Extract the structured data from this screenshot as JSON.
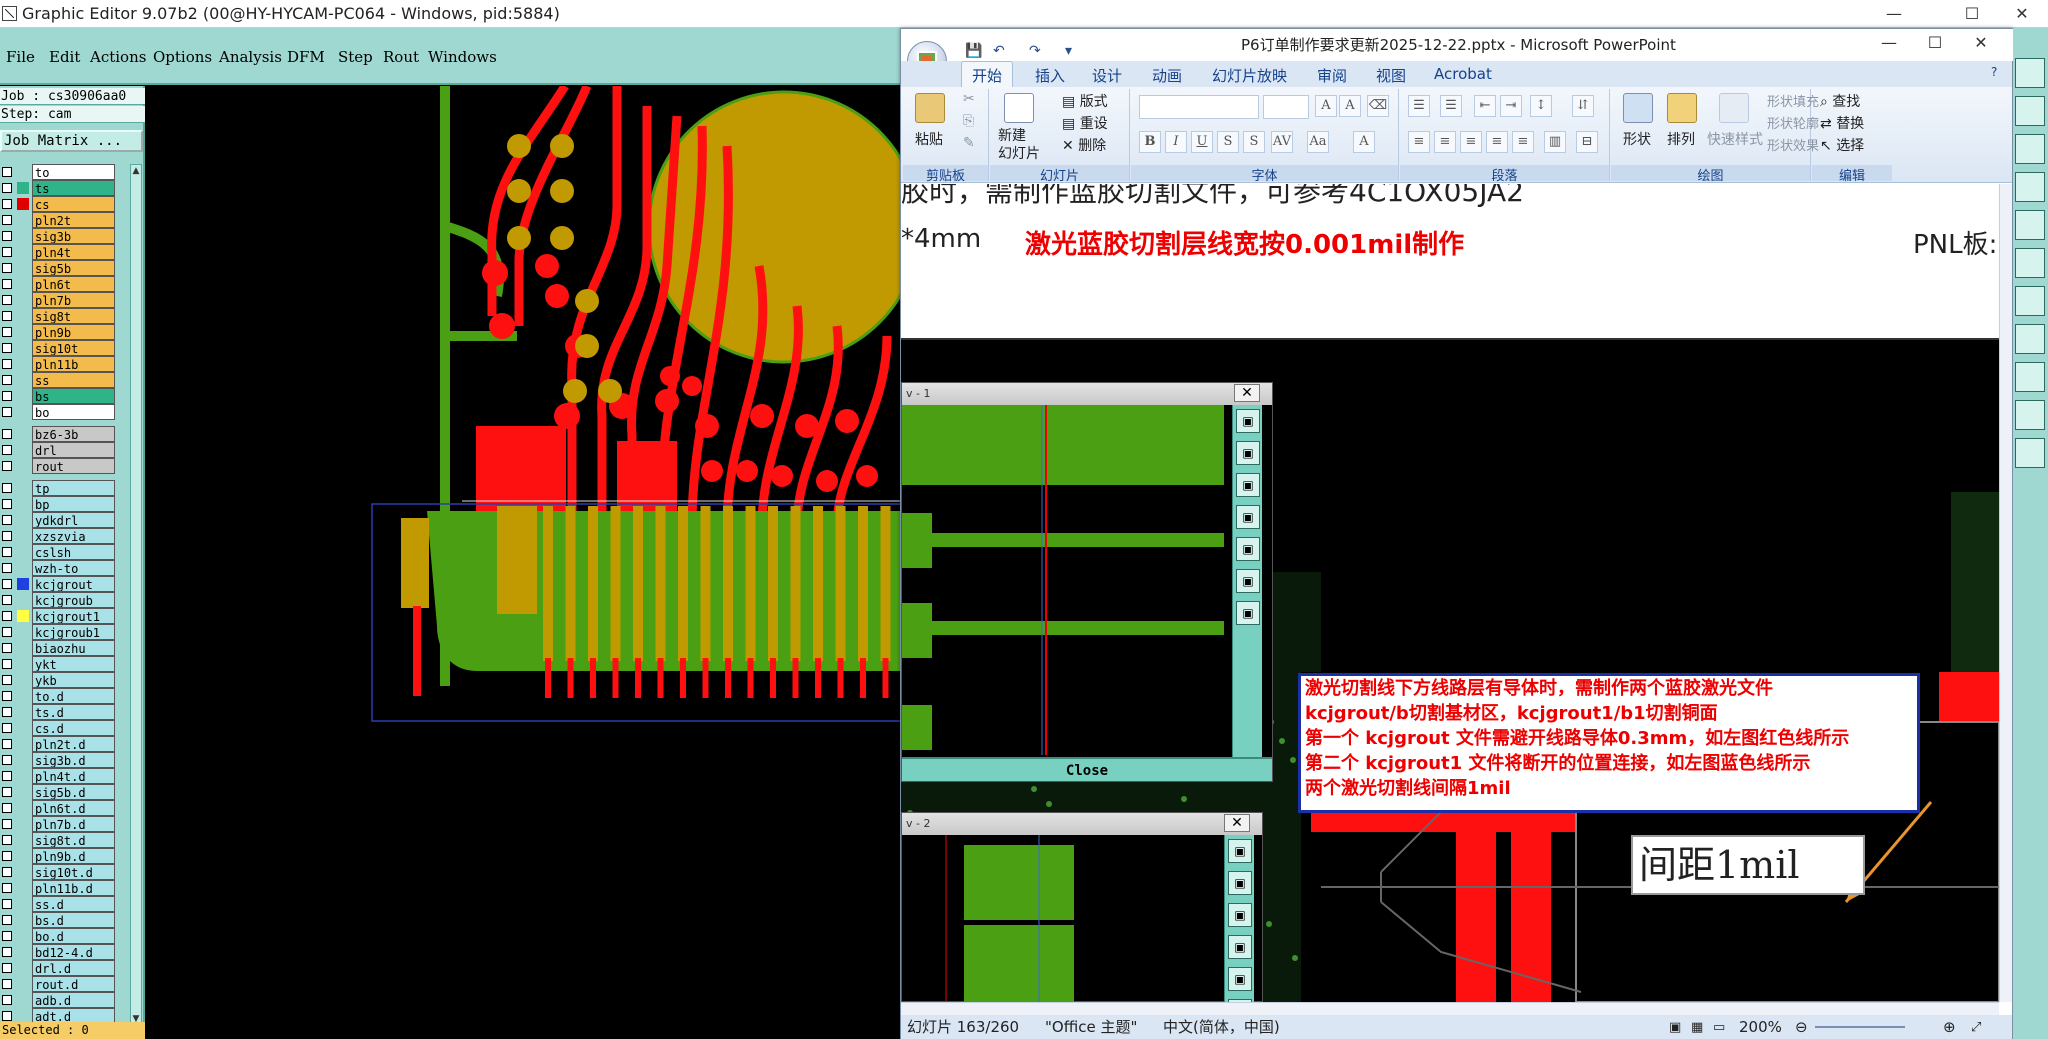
{
  "ge": {
    "title": "Graphic Editor 9.07b2 (00@HY-HYCAM-PC064 - Windows, pid:5884)",
    "menu": [
      "File",
      "Edit",
      "Actions",
      "Options",
      "Analysis",
      "DFM",
      "Step",
      "Rout",
      "Windows"
    ],
    "job": "Job : cs30906aa0",
    "step": "Step: cam",
    "job_matrix": "Job Matrix ...",
    "status": "Selected : 0",
    "layers": [
      {
        "name": "to",
        "color": "#ffffff",
        "swatch": ""
      },
      {
        "name": "ts",
        "color": "#2fb48a",
        "swatch": "#2fb48a"
      },
      {
        "name": "cs",
        "color": "#f3bb4c",
        "swatch": "#e00000"
      },
      {
        "name": "pln2t",
        "color": "#f3bb4c",
        "swatch": ""
      },
      {
        "name": "sig3b",
        "color": "#f3bb4c",
        "swatch": ""
      },
      {
        "name": "pln4t",
        "color": "#f3bb4c",
        "swatch": ""
      },
      {
        "name": "sig5b",
        "color": "#f3bb4c",
        "swatch": ""
      },
      {
        "name": "pln6t",
        "color": "#f3bb4c",
        "swatch": ""
      },
      {
        "name": "pln7b",
        "color": "#f3bb4c",
        "swatch": ""
      },
      {
        "name": "sig8t",
        "color": "#f3bb4c",
        "swatch": ""
      },
      {
        "name": "pln9b",
        "color": "#f3bb4c",
        "swatch": ""
      },
      {
        "name": "sig10t",
        "color": "#f3bb4c",
        "swatch": ""
      },
      {
        "name": "pln11b",
        "color": "#f3bb4c",
        "swatch": ""
      },
      {
        "name": "ss",
        "color": "#f3bb4c",
        "swatch": ""
      },
      {
        "name": "bs",
        "color": "#2fb48a",
        "swatch": ""
      },
      {
        "name": "bo",
        "color": "#ffffff",
        "swatch": ""
      },
      {
        "name": "bz6-3b",
        "color": "#c8c8c8",
        "swatch": ""
      },
      {
        "name": "drl",
        "color": "#c8c8c8",
        "swatch": ""
      },
      {
        "name": "rout",
        "color": "#c8c8c8",
        "swatch": ""
      },
      {
        "name": "tp",
        "color": "#a8e2e8",
        "swatch": ""
      },
      {
        "name": "bp",
        "color": "#a8e2e8",
        "swatch": ""
      },
      {
        "name": "ydkdrl",
        "color": "#a8e2e8",
        "swatch": ""
      },
      {
        "name": "xzszvia",
        "color": "#a8e2e8",
        "swatch": ""
      },
      {
        "name": "cslsh",
        "color": "#a8e2e8",
        "swatch": ""
      },
      {
        "name": "wzh-to",
        "color": "#a8e2e8",
        "swatch": ""
      },
      {
        "name": "kcjgrout",
        "color": "#a8e2e8",
        "swatch": "#2040e0"
      },
      {
        "name": "kcjgroub",
        "color": "#a8e2e8",
        "swatch": ""
      },
      {
        "name": "kcjgrout1",
        "color": "#a8e2e8",
        "swatch": "#ffff40"
      },
      {
        "name": "kcjgroub1",
        "color": "#a8e2e8",
        "swatch": ""
      },
      {
        "name": "biaozhu",
        "color": "#a8e2e8",
        "swatch": ""
      },
      {
        "name": "ykt",
        "color": "#a8e2e8",
        "swatch": ""
      },
      {
        "name": "ykb",
        "color": "#a8e2e8",
        "swatch": ""
      },
      {
        "name": "to.d",
        "color": "#a8e2e8",
        "swatch": ""
      },
      {
        "name": "ts.d",
        "color": "#a8e2e8",
        "swatch": ""
      },
      {
        "name": "cs.d",
        "color": "#a8e2e8",
        "swatch": ""
      },
      {
        "name": "pln2t.d",
        "color": "#a8e2e8",
        "swatch": ""
      },
      {
        "name": "sig3b.d",
        "color": "#a8e2e8",
        "swatch": ""
      },
      {
        "name": "pln4t.d",
        "color": "#a8e2e8",
        "swatch": ""
      },
      {
        "name": "sig5b.d",
        "color": "#a8e2e8",
        "swatch": ""
      },
      {
        "name": "pln6t.d",
        "color": "#a8e2e8",
        "swatch": ""
      },
      {
        "name": "pln7b.d",
        "color": "#a8e2e8",
        "swatch": ""
      },
      {
        "name": "sig8t.d",
        "color": "#a8e2e8",
        "swatch": ""
      },
      {
        "name": "pln9b.d",
        "color": "#a8e2e8",
        "swatch": ""
      },
      {
        "name": "sig10t.d",
        "color": "#a8e2e8",
        "swatch": ""
      },
      {
        "name": "pln11b.d",
        "color": "#a8e2e8",
        "swatch": ""
      },
      {
        "name": "ss.d",
        "color": "#a8e2e8",
        "swatch": ""
      },
      {
        "name": "bs.d",
        "color": "#a8e2e8",
        "swatch": ""
      },
      {
        "name": "bo.d",
        "color": "#a8e2e8",
        "swatch": ""
      },
      {
        "name": "bd12-4.d",
        "color": "#a8e2e8",
        "swatch": ""
      },
      {
        "name": "drl.d",
        "color": "#a8e2e8",
        "swatch": ""
      },
      {
        "name": "rout.d",
        "color": "#a8e2e8",
        "swatch": ""
      },
      {
        "name": "adb.d",
        "color": "#a8e2e8",
        "swatch": ""
      },
      {
        "name": "adt.d",
        "color": "#a8e2e8",
        "swatch": ""
      }
    ]
  },
  "ppt": {
    "title": "P6订单制作要求更新2025-12-22.pptx - Microsoft PowerPoint",
    "tabs": [
      "开始",
      "插入",
      "设计",
      "动画",
      "幻灯片放映",
      "审阅",
      "视图",
      "Acrobat"
    ],
    "groups": {
      "clipboard": "剪贴板",
      "slides": "幻灯片",
      "font": "字体",
      "paragraph": "段落",
      "drawing": "绘图",
      "editing": "编辑"
    },
    "buttons": {
      "paste": "粘贴",
      "new_slide": "新建\n幻灯片",
      "layout": "版式",
      "reset": "重设",
      "delete": "删除",
      "shape": "形状",
      "arrange": "排列",
      "quick_style": "快速样式",
      "shape_fill": "形状填充",
      "shape_outline": "形状轮廓",
      "shape_effect": "形状效果",
      "find": "查找",
      "replace": "替换",
      "select": "选择"
    },
    "slide": {
      "top_partial": "胶时，需制作蓝胶切割文件，可参考4C1OX05JA2",
      "left_text": "*4mm",
      "red_heading": "激光蓝胶切割层线宽按0.001mil制作",
      "right_text": "PNL板:",
      "note_lines": [
        "激光切割线下方线路层有导体时，需制作两个蓝胶激光文件",
        "kcjgrout/b切割基材区，kcjgrout1/b1切割铜面",
        "第一个 kcjgrout 文件需避开线路导体0.3mm，如左图红色线所示",
        "第二个 kcjgrout1 文件将断开的位置连接，如左图蓝色线所示",
        "两个激光切割线间隔1mil"
      ],
      "sub1_title": "v - 1",
      "sub2_title": "v - 2",
      "close_label": "Close",
      "spacing_label": "间距1mil"
    },
    "status": {
      "slide": "幻灯片 163/260",
      "theme": "\"Office 主题\"",
      "lang": "中文(简体，中国)",
      "zoom": "200%"
    }
  },
  "colors": {
    "copper": "#ff1010",
    "solder": "#c09a00",
    "green": "#4aa012",
    "ge_bg": "#9fd8d1"
  }
}
